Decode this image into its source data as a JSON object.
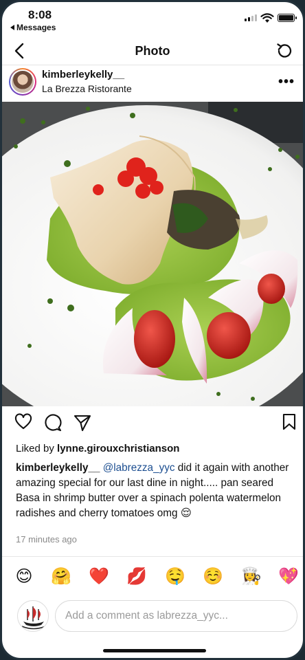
{
  "status": {
    "time": "8:08",
    "back_app": "Messages"
  },
  "nav": {
    "title": "Photo",
    "back_icon": "chevron-left-icon",
    "refresh_icon": "refresh-icon"
  },
  "post": {
    "username": "kimberleykelly__",
    "location": "La Brezza Ristorante",
    "more_icon": "more-icon"
  },
  "likes": {
    "prefix": "Liked by ",
    "user": "lynne.girouxchristianson"
  },
  "caption": {
    "username": "kimberleykelly__",
    "mention": "@labrezza_yyc",
    "text": " did it again with another amazing special for our last dine in night..... pan seared Basa in shrimp butter over a spinach polenta watermelon radishes and cherry tomatoes omg 😌"
  },
  "time_ago": "17 minutes ago",
  "reactions": [
    "😊",
    "🤗",
    "❤️",
    "💋",
    "🤤",
    "☺️",
    "👩‍🍳",
    "💖"
  ],
  "comment": {
    "placeholder": "Add a comment as labrezza_yyc..."
  },
  "colors": {
    "mention": "#1d4f91",
    "polenta": "#8fbf3a",
    "tomato": "#c0201b"
  }
}
